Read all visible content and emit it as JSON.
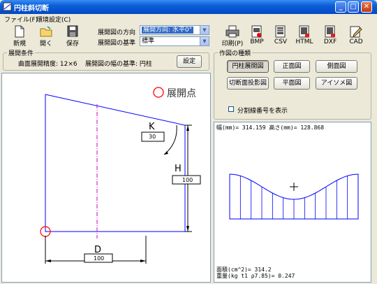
{
  "window": {
    "title": "円柱斜切断"
  },
  "menu": {
    "file": "ファイル(F)",
    "settings": "環境設定(C)"
  },
  "toolbar": {
    "new": "新規",
    "open": "開く",
    "save": "保存",
    "print": "印刷(P)",
    "bmp": "BMP",
    "csv": "CSV",
    "html": "HTML",
    "dxf": "DXF",
    "cad": "CAD"
  },
  "direction": {
    "label": "展開図の方向",
    "value": "展開方向: 水平0°"
  },
  "basis": {
    "label": "展開図の基準",
    "value": "標準"
  },
  "conditions": {
    "title": "展開条件",
    "precision": "曲面展開精度: 12×6",
    "width_basis": "展開図の幅の基準: 円柱",
    "settings_button": "設定"
  },
  "drawing_types": {
    "title": "作図の種類",
    "buttons": [
      "円柱展開図",
      "正面図",
      "側面図",
      "切断面投影図",
      "平面図",
      "アイソメ図"
    ],
    "selected": 0
  },
  "show_numbers": {
    "label": "分割線番号を表示",
    "checked": false
  },
  "left_view": {
    "legend_label": "展開点",
    "k_label": "K",
    "k_value": "30",
    "h_label": "H",
    "h_value": "100",
    "d_label": "D",
    "d_value": "100"
  },
  "right_view": {
    "header": "幅(mm)= 314.159  高さ(mm)= 128.868",
    "area": "面積(cm^2)= 314.2",
    "weight": "重量(kg t1 ρ7.85)= 0.247"
  },
  "colors": {
    "blue": "#0000ff",
    "red": "#ff0000",
    "magenta": "#cc00cc",
    "accent": "#316ac5"
  }
}
